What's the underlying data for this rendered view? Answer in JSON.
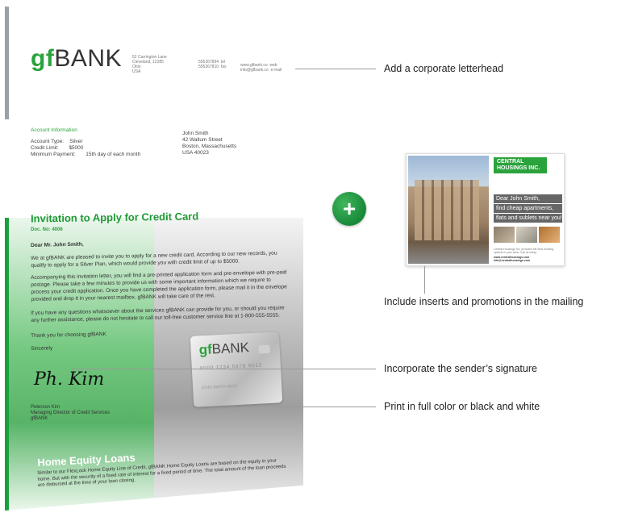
{
  "letter": {
    "logo_gf": "gf",
    "logo_bank": "BANK",
    "address_lines": "52 Carrington Lane\nCleveland, 12285\nOhio\nUSA",
    "phone_lines": "555367894  tel\n555367810  fax",
    "web_lines": "www.gfbank.co  web\ninfo@gfbank.co  e-mail",
    "account_title": "Account Information",
    "account_lines": "Account Type:    Silver\nCredit Limit:       $5000\nMinimum Payment:       15th day of each month",
    "recipient_lines": "John Smith\n42 Wallum Street\nBoston, Massachusetts\nUSA 40023",
    "invitation_title": "Invitation to Apply for Credit Card",
    "doc_no": "Doc. No: 4006",
    "salutation": "Dear Mr. John Smith,",
    "para1": "We at gfBANK are pleased to invite you to apply for a new credit card. According to our new records, you qualify to apply for a Silver Plan, which would provide you with credit limit of up to $5000.",
    "para2": "Accompanying this invitation letter, you will find a pre-printed application form and pre-envelope with pre-paid postage. Please take a few minutes to provide us with some important information which we require to process your credit application. Once you have completed the application form, please mail it in the envelope provided and drop it in your nearest mailbox. gfBANK will take care of the rest.",
    "para3": "If you have any questions whatsoever about the services gfBANK can provide for you, or should you require any further assistance, please do not hesitate to call our toll-free customer service line at 1-800-555-5555.",
    "thanks": "Thank you for choosing gfBANK",
    "closing": "Sincerely",
    "signature": "Ph. Kim",
    "signer_lines": "Peterson Kim\nManaging Director of Credit Services\ngfBANK",
    "card_gf": "gf",
    "card_bank": "BANK",
    "card_number": "0000 1234 5678 9012",
    "card_holder": "JOHN SMITH   08/15",
    "hel_title": "Home Equity Loans",
    "hel_text": "Similar to our FlexLock Home Equity Line of Credit, gfBANK Home Equity Loans are based on the equity in your home. But with the security of a fixed rate of interest for a fixed period of time. The total amount of the loan proceeds are disbursed at the time of your loan closing."
  },
  "insert": {
    "brand": "CENTRAL HOUSINGS INC.",
    "line1": "Dear John Smith,",
    "line2": "find cheap apartments,",
    "line3": "flats and sublets near you!",
    "fine_print": "Central Housings Inc. provides the best housing options in your area. Call us today.",
    "fine_bold": "www.centralhousings.com   info@centralhousings.com"
  },
  "plus_symbol": "+",
  "callouts": {
    "letterhead": "Add a corporate letterhead",
    "inserts": "Include inserts and promotions in the mailing",
    "signature": "Incorporate the sender’s signature",
    "color": "Print in full color or black and white"
  },
  "colors": {
    "brand_green": "#2aa33c",
    "callout_line": "#9a9a9a"
  }
}
